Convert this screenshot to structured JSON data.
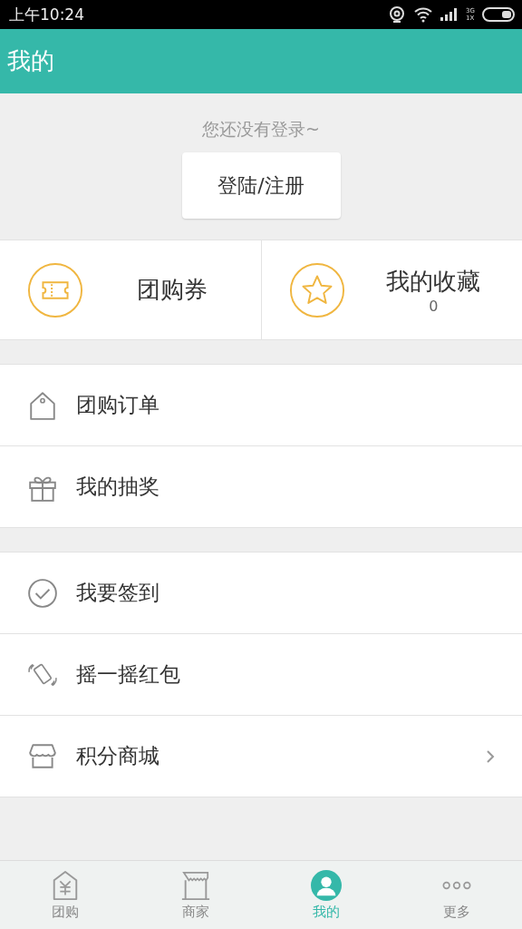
{
  "status_bar": {
    "time": "上午10:24",
    "network_top": "3G",
    "network_bottom": "1X"
  },
  "header": {
    "title": "我的"
  },
  "login": {
    "prompt": "您还没有登录~",
    "button": "登陆/注册"
  },
  "quick_cards": [
    {
      "label": "团购券"
    },
    {
      "label": "我的收藏",
      "count": "0"
    }
  ],
  "menu_groups": [
    [
      {
        "label": "团购订单",
        "arrow": false
      },
      {
        "label": "我的抽奖",
        "arrow": false
      }
    ],
    [
      {
        "label": "我要签到",
        "arrow": false
      },
      {
        "label": "摇一摇红包",
        "arrow": false
      },
      {
        "label": "积分商城",
        "arrow": true
      }
    ]
  ],
  "tabs": [
    {
      "label": "团购",
      "selected": false
    },
    {
      "label": "商家",
      "selected": false
    },
    {
      "label": "我的",
      "selected": true
    },
    {
      "label": "更多",
      "selected": false
    }
  ]
}
